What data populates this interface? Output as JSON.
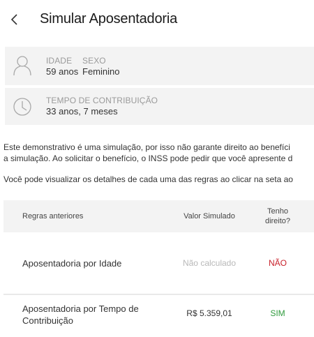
{
  "header": {
    "title": "Simular Aposentadoria"
  },
  "profile": {
    "age_label": "IDADE",
    "age_value": "59 anos",
    "sex_label": "SEXO",
    "sex_value": "Feminino",
    "contribution_label": "TEMPO DE CONTRIBUIÇÃO",
    "contribution_value": "33 anos, 7 meses"
  },
  "disclaimer": {
    "line1": "Este demonstrativo é uma simulação, por isso não garante direito ao benefíci",
    "line2": "a simulação. Ao solicitar o benefício, o INSS pode pedir que você apresente d",
    "line3": "Você pode visualizar os detalhes de cada uma das regras ao clicar na seta ao"
  },
  "table": {
    "col_rules": "Regras anteriores",
    "col_value": "Valor Simulado",
    "col_right_line1": "Tenho",
    "col_right_line2": "direito?",
    "rows": [
      {
        "name": "Aposentadoria por Idade",
        "value": "Não calculado",
        "right": "NÃO"
      },
      {
        "name_line1": "Aposentadoria por Tempo de",
        "name_line2": "Contribuição",
        "value": "R$ 5.359,01",
        "right": "SIM"
      }
    ]
  },
  "colors": {
    "negative": "#c8202a",
    "positive": "#2e9a3c",
    "muted": "#b8b8b8",
    "card_bg": "#f3f3f3"
  },
  "icons": {
    "back": "chevron-left-icon",
    "person": "person-icon",
    "clock": "clock-icon"
  }
}
